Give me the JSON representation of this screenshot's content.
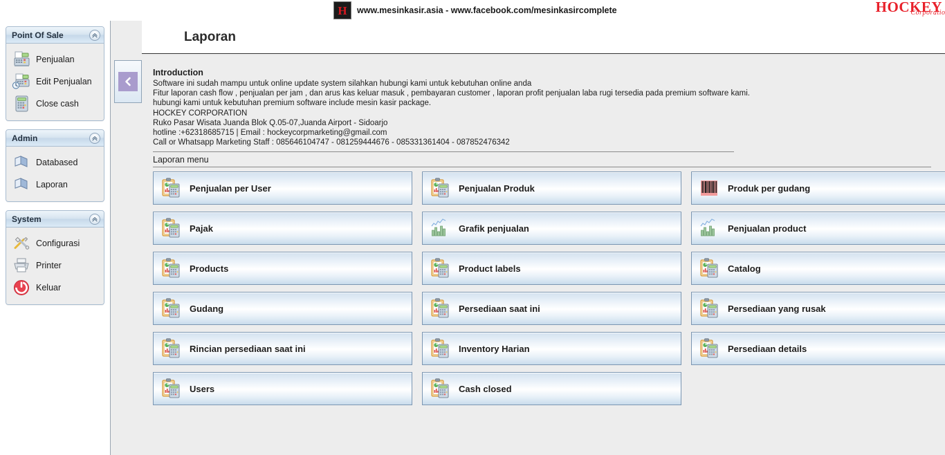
{
  "topbar": {
    "logo_letter": "H",
    "text": "www.mesinkasir.asia - www.facebook.com/mesinkasircomplete",
    "brand_main": "HOCKEY",
    "brand_sub": "Corporation"
  },
  "sidebar": {
    "panels": [
      {
        "title": "Point Of Sale",
        "items": [
          {
            "label": "Penjualan",
            "icon": "cash-register-icon"
          },
          {
            "label": "Edit Penjualan",
            "icon": "cash-register-clock-icon"
          },
          {
            "label": "Close cash",
            "icon": "calculator-icon"
          }
        ]
      },
      {
        "title": "Admin",
        "items": [
          {
            "label": "Databased",
            "icon": "book-icon"
          },
          {
            "label": "Laporan",
            "icon": "book-icon"
          }
        ]
      },
      {
        "title": "System",
        "items": [
          {
            "label": "Configurasi",
            "icon": "tools-icon"
          },
          {
            "label": "Printer",
            "icon": "printer-icon"
          },
          {
            "label": "Keluar",
            "icon": "power-icon"
          }
        ]
      }
    ]
  },
  "main": {
    "page_title": "Laporan",
    "intro_heading": "Introduction",
    "intro_lines": [
      "Software ini sudah mampu untuk online update system silahkan hubungi kami untuk kebutuhan online anda",
      "Fitur laporan cash flow , penjualan per jam , dan arus kas keluar masuk , pembayaran customer , laporan profit penjualan laba rugi tersedia pada premium software kami.",
      "hubungi kami untuk kebutuhan premium software include mesin kasir package.",
      "HOCKEY CORPORATION",
      "Ruko Pasar Wisata Juanda Blok Q.05-07,Juanda Airport - Sidoarjo",
      "hotline :+62318685715 | Email : hockeycorpmarketing@gmail.com",
      "Call or Whatsapp Marketing Staff : 085646104747 - 081259444676 - 085331361404 - 087852476342"
    ],
    "menu_label": "Laporan menu",
    "tiles": [
      {
        "label": "Penjualan per User",
        "icon": "report-clipboard-icon"
      },
      {
        "label": "Penjualan Produk",
        "icon": "report-clipboard-icon"
      },
      {
        "label": "Produk per gudang",
        "icon": "barcode-icon"
      },
      {
        "label": "Pajak",
        "icon": "report-clipboard-icon"
      },
      {
        "label": "Grafik penjualan",
        "icon": "chart-icon"
      },
      {
        "label": "Penjualan product",
        "icon": "chart-icon"
      },
      {
        "label": "Products",
        "icon": "report-clipboard-icon"
      },
      {
        "label": "Product labels",
        "icon": "report-clipboard-icon"
      },
      {
        "label": "Catalog",
        "icon": "report-clipboard-icon"
      },
      {
        "label": "Gudang",
        "icon": "report-clipboard-icon"
      },
      {
        "label": "Persediaan saat ini",
        "icon": "report-clipboard-icon"
      },
      {
        "label": "Persediaan yang rusak",
        "icon": "report-clipboard-icon"
      },
      {
        "label": "Rincian persediaan saat ini",
        "icon": "report-clipboard-icon"
      },
      {
        "label": "Inventory Harian",
        "icon": "report-clipboard-icon"
      },
      {
        "label": "Persediaan details",
        "icon": "report-clipboard-icon"
      },
      {
        "label": "Users",
        "icon": "report-clipboard-icon"
      },
      {
        "label": "Cash closed",
        "icon": "report-clipboard-icon"
      }
    ]
  },
  "colors": {
    "brand_red": "#e8202a",
    "accent_purple": "#a99ccd",
    "panel_border": "#a8bcd0",
    "content_bg": "#ededed"
  }
}
